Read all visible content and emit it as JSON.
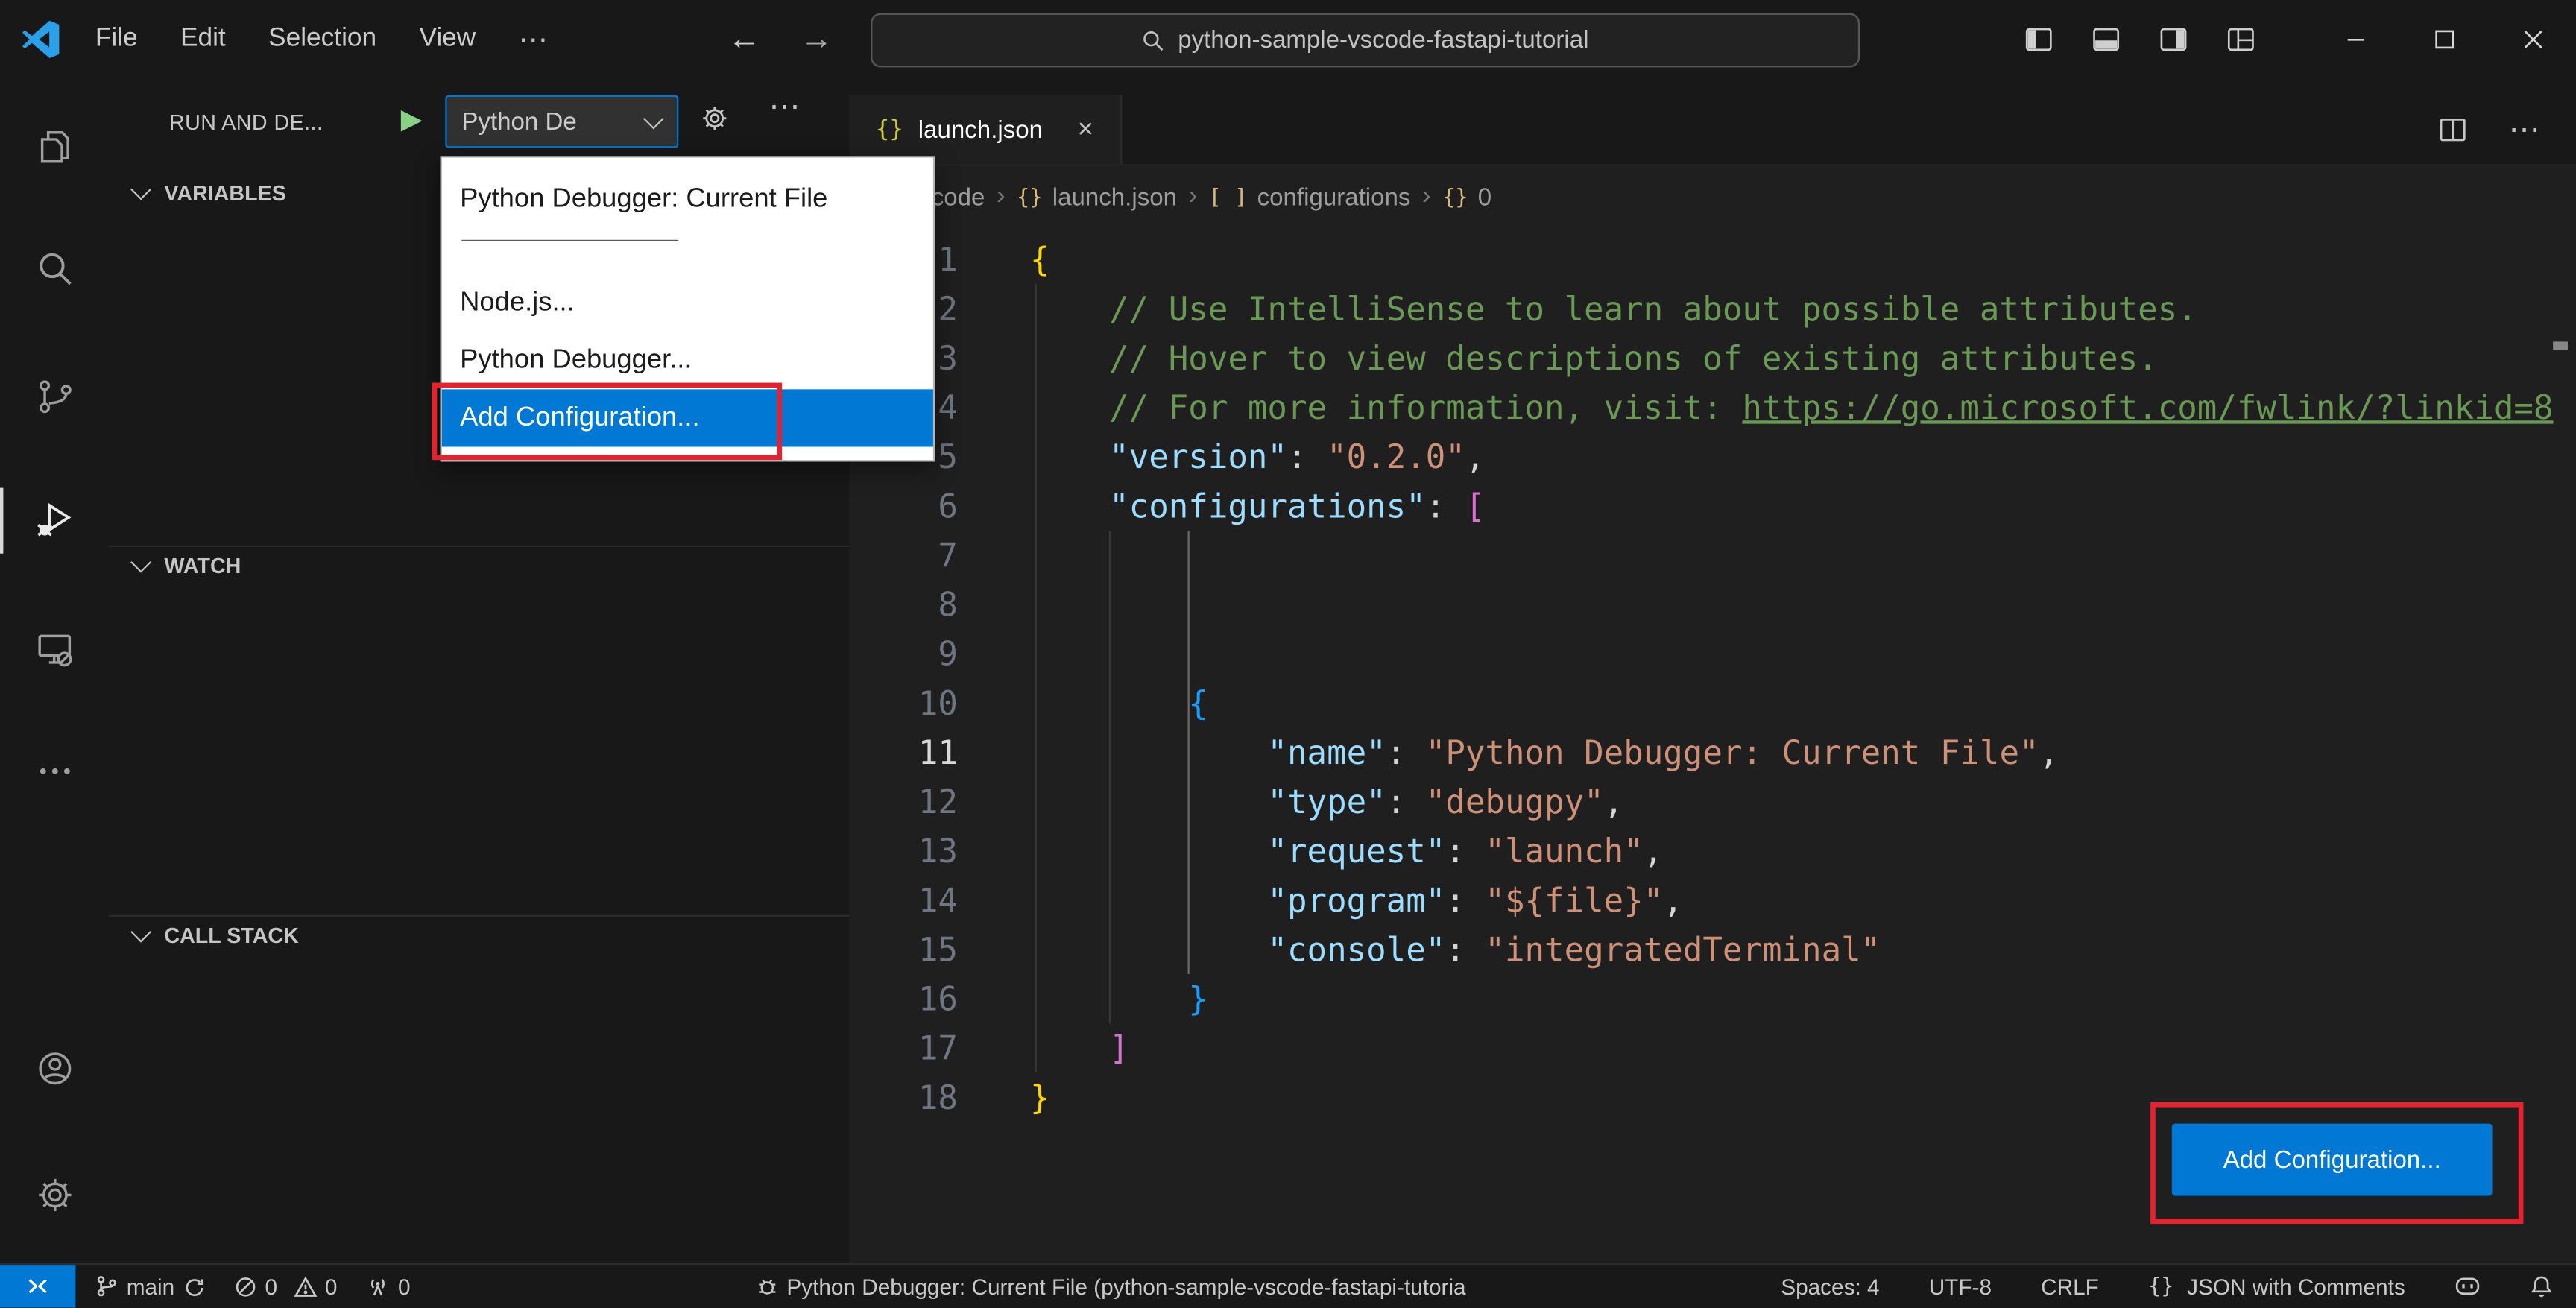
{
  "icons": {
    "ellipsis": "⋯",
    "back_arrow": "←",
    "forward_arrow": "→",
    "play": "▶",
    "tab_close": "×",
    "activity_bar_items": [
      "explorer-icon",
      "search-icon",
      "source-control-icon",
      "run-and-debug-icon",
      "remote-explorer-icon",
      "more-views-icon",
      "accounts-icon",
      "settings-gear-icon"
    ],
    "activity_bar_active": "run-and-debug"
  },
  "titlebar": {
    "menus": [
      "File",
      "Edit",
      "Selection",
      "View"
    ],
    "search_value": "python-sample-vscode-fastapi-tutorial"
  },
  "sidebar": {
    "title": "RUN AND DE...",
    "config_picker_value": "Python De",
    "sections": [
      "VARIABLES",
      "WATCH",
      "CALL STACK"
    ]
  },
  "debug_dropdown": {
    "items": [
      {
        "label": "Python Debugger: Current File",
        "selected": false
      },
      {
        "label": "Node.js...",
        "selected": false
      },
      {
        "label": "Python Debugger...",
        "selected": false
      },
      {
        "label": "Add Configuration...",
        "selected": true
      }
    ]
  },
  "editor": {
    "tab_icon": "{}",
    "tab_label": "launch.json",
    "breadcrumb": [
      {
        "icon": "",
        "label": "code"
      },
      {
        "icon": "{}",
        "label": "launch.json"
      },
      {
        "icon": "[ ]",
        "label": "configurations"
      },
      {
        "icon": "{}",
        "label": "0"
      }
    ],
    "add_config_button": "Add Configuration...",
    "active_line": 11,
    "lines": [
      {
        "tokens": [
          [
            "{",
            "b1"
          ]
        ]
      },
      {
        "tokens": [
          [
            "    // Use IntelliSense to learn about possible attributes.",
            "comment"
          ]
        ]
      },
      {
        "tokens": [
          [
            "    // Hover to view descriptions of existing attributes.",
            "comment"
          ]
        ]
      },
      {
        "tokens": [
          [
            "    // For more information, visit: ",
            "comment"
          ],
          [
            "https://go.microsoft.com/fwlink/?linkid=8",
            "link"
          ]
        ]
      },
      {
        "tokens": [
          [
            "    ",
            ""
          ],
          [
            "\"version\"",
            "key"
          ],
          [
            ": ",
            "punct"
          ],
          [
            "\"0.2.0\"",
            "str"
          ],
          [
            ",",
            "punct"
          ]
        ]
      },
      {
        "tokens": [
          [
            "    ",
            ""
          ],
          [
            "\"configurations\"",
            "key"
          ],
          [
            ": ",
            "punct"
          ],
          [
            "[",
            "b2"
          ]
        ]
      },
      {
        "tokens": []
      },
      {
        "tokens": []
      },
      {
        "tokens": []
      },
      {
        "tokens": [
          [
            "        ",
            ""
          ],
          [
            "{",
            "b3"
          ]
        ]
      },
      {
        "tokens": [
          [
            "            ",
            ""
          ],
          [
            "\"name\"",
            "key"
          ],
          [
            ": ",
            "punct"
          ],
          [
            "\"Python Debugger: Current File\"",
            "str"
          ],
          [
            ",",
            "punct"
          ]
        ]
      },
      {
        "tokens": [
          [
            "            ",
            ""
          ],
          [
            "\"type\"",
            "key"
          ],
          [
            ": ",
            "punct"
          ],
          [
            "\"debugpy\"",
            "str"
          ],
          [
            ",",
            "punct"
          ]
        ]
      },
      {
        "tokens": [
          [
            "            ",
            ""
          ],
          [
            "\"request\"",
            "key"
          ],
          [
            ": ",
            "punct"
          ],
          [
            "\"launch\"",
            "str"
          ],
          [
            ",",
            "punct"
          ]
        ]
      },
      {
        "tokens": [
          [
            "            ",
            ""
          ],
          [
            "\"program\"",
            "key"
          ],
          [
            ": ",
            "punct"
          ],
          [
            "\"${file}\"",
            "str"
          ],
          [
            ",",
            "punct"
          ]
        ]
      },
      {
        "tokens": [
          [
            "            ",
            ""
          ],
          [
            "\"console\"",
            "key"
          ],
          [
            ": ",
            "punct"
          ],
          [
            "\"integratedTerminal\"",
            "str"
          ]
        ]
      },
      {
        "tokens": [
          [
            "        ",
            ""
          ],
          [
            "}",
            "b3"
          ]
        ]
      },
      {
        "tokens": [
          [
            "    ",
            ""
          ],
          [
            "]",
            "b2"
          ]
        ]
      },
      {
        "tokens": [
          [
            "}",
            "b1"
          ]
        ]
      }
    ]
  },
  "statusbar": {
    "branch": "main",
    "errors": "0",
    "warnings": "0",
    "ports": "0",
    "debug_status": "Python Debugger: Current File (python-sample-vscode-fastapi-tutoria",
    "indentation": "Spaces: 4",
    "encoding": "UTF-8",
    "eol": "CRLF",
    "language_icon": "{}",
    "language": "JSON with Comments"
  }
}
